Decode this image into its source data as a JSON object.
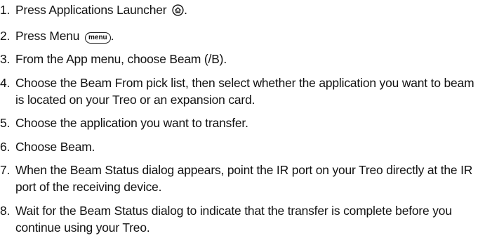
{
  "steps": [
    {
      "number": "1.",
      "text": "Press Applications Launcher",
      "icon": "home-icon",
      "suffix": "."
    },
    {
      "number": "2.",
      "text": "Press Menu",
      "key_label": "menu",
      "suffix": "."
    },
    {
      "number": "3.",
      "text": "From the App menu, choose Beam (/B)."
    },
    {
      "number": "4.",
      "text": "Choose the Beam From pick list, then select whether the application you want to beam is located on your Treo or an expansion card."
    },
    {
      "number": "5.",
      "text": "Choose the application you want to transfer."
    },
    {
      "number": "6.",
      "text": "Choose Beam."
    },
    {
      "number": "7.",
      "text": "When the Beam Status dialog appears, point the IR port on your Treo directly at the IR port of the receiving device."
    },
    {
      "number": "8.",
      "text": "Wait for the Beam Status dialog to indicate that the transfer is complete before you continue using your Treo."
    }
  ]
}
